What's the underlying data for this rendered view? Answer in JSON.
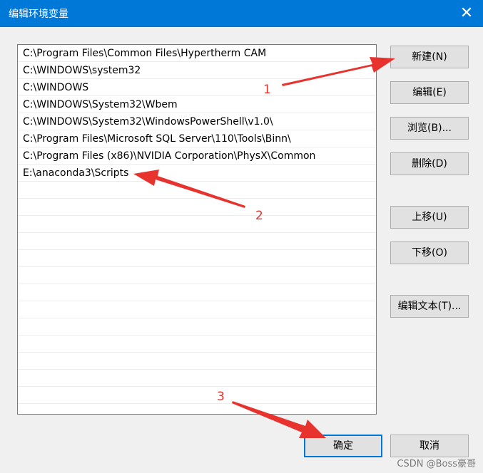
{
  "window": {
    "title": "编辑环境变量",
    "close_icon": "✕"
  },
  "paths": [
    "C:\\Program Files\\Common Files\\Hypertherm CAM",
    "C:\\WINDOWS\\system32",
    "C:\\WINDOWS",
    "C:\\WINDOWS\\System32\\Wbem",
    "C:\\WINDOWS\\System32\\WindowsPowerShell\\v1.0\\",
    "C:\\Program Files\\Microsoft SQL Server\\110\\Tools\\Binn\\",
    "C:\\Program Files (x86)\\NVIDIA Corporation\\PhysX\\Common",
    "E:\\anaconda3\\Scripts"
  ],
  "buttons": {
    "new": "新建(N)",
    "edit": "编辑(E)",
    "browse": "浏览(B)...",
    "delete": "删除(D)",
    "move_up": "上移(U)",
    "move_down": "下移(O)",
    "edit_text": "编辑文本(T)...",
    "ok": "确定",
    "cancel": "取消"
  },
  "annotations": {
    "one": "1",
    "two": "2",
    "three": "3",
    "color": "#e8322d"
  },
  "watermark": "CSDN @Boss豪哥"
}
